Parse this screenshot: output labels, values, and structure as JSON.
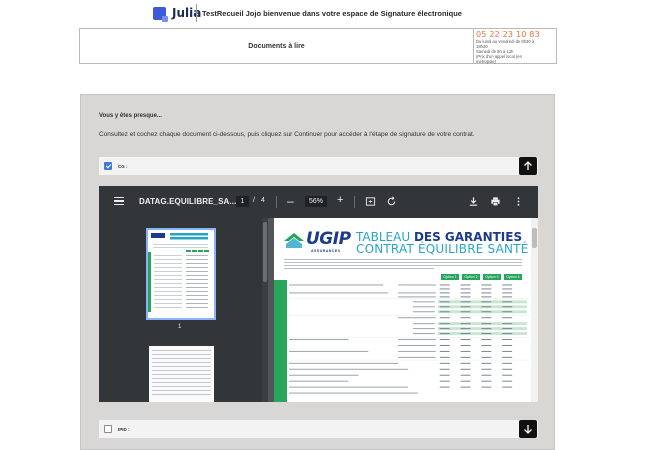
{
  "header": {
    "logo_text": "Julia",
    "title": "TestRecueil Jojo bienvenue dans votre espace de Signature électronique"
  },
  "documents_box": {
    "title": "Documents à lire",
    "phone": "05 22 23 10 83",
    "contact_lines": [
      "Du lundi au vendredi de 8h30 à",
      "18h30",
      "Samedi de 9h à 12h",
      "(Prix d'un appel local (en",
      "métropole)"
    ]
  },
  "panel": {
    "heading": "Vous y êtes presque...",
    "instructions": "Consultez et cochez chaque document ci-dessous, puis cliquez sur Continuer pour accéder à l'étape de signature de votre contrat.",
    "documents": [
      {
        "label": "CG :",
        "checked": true
      },
      {
        "label": "IPID :",
        "checked": false
      }
    ]
  },
  "viewer": {
    "filename": "DATAG.EQUILIBRE_SA...",
    "current_page": "1",
    "page_sep": "/",
    "total_pages": "4",
    "zoom": "56%",
    "minus": "–",
    "plus": "+",
    "thumb_label": "1"
  },
  "pdf_page": {
    "brand": "UGIP",
    "brand_sub": "ASSURANCES",
    "title_prefix": "TABLEAU",
    "title_bold": "DES GARANTIES",
    "title_line2": "CONTRAT ÉQUILIBRE SANTÉ",
    "options": [
      "Option 1",
      "Option 2",
      "Option 3",
      "Option 4"
    ]
  },
  "colors": {
    "panel_bg": "#d9d6d6",
    "accent_orange": "#e8743b",
    "checkbox_blue": "#3d7be0",
    "viewer_toolbar": "#323639",
    "ugip_green": "#27a55a",
    "ugip_blue": "#1c3a8e"
  }
}
